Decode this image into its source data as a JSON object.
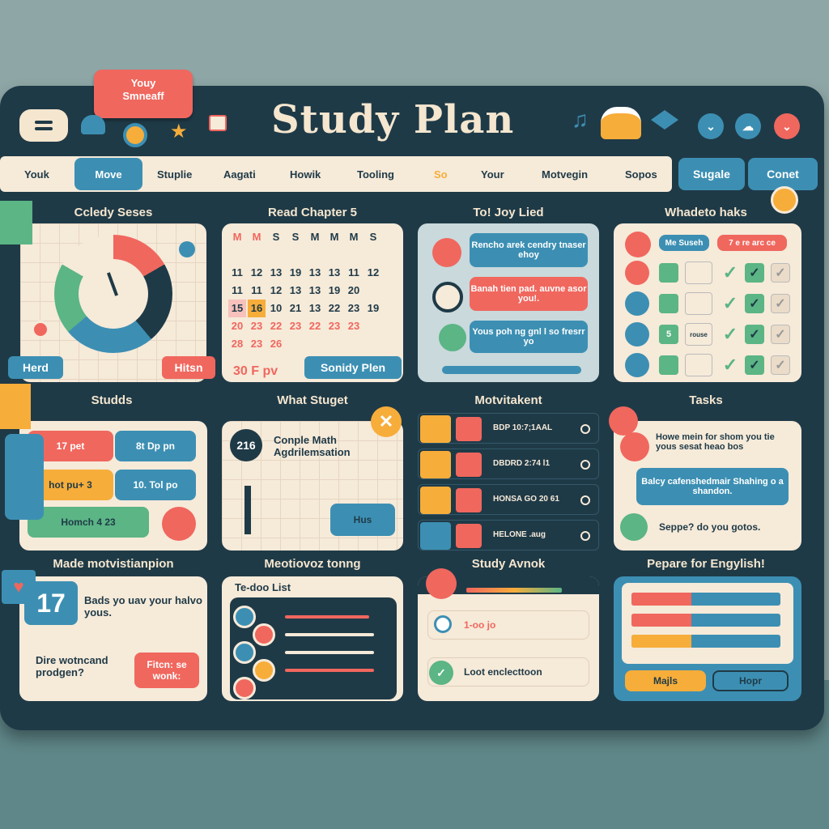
{
  "header": {
    "title": "Study Plan",
    "note": "Youy\nSmneaff"
  },
  "nav": {
    "items": [
      "Youk",
      "Move",
      "Stuplie",
      "Aagati",
      "Howik",
      "Tooling",
      "So",
      "Your",
      "Motvegin",
      "Sopos"
    ],
    "right_primary": "Sugale",
    "right_secondary": "Conet"
  },
  "panels": {
    "p1": {
      "title": "Ccledy Seses",
      "left_btn": "Herd",
      "right_btn": "Hitsn"
    },
    "p2": {
      "title": "Read Chapter 5",
      "footer_text": "30 F pv",
      "footer_btn": "Sonidy Plen",
      "cal_header": [
        "M",
        "M",
        "S",
        "S",
        "M",
        "M",
        "M",
        "S"
      ],
      "cal_rows": [
        [
          "",
          "",
          "",
          "",
          "",
          "",
          "",
          ""
        ],
        [
          "11",
          "12",
          "13",
          "19",
          "13",
          "13",
          "11",
          "12"
        ],
        [
          "11",
          "11",
          "12",
          "13",
          "13",
          "19",
          "20",
          ""
        ],
        [
          "15",
          "16",
          "10",
          "21",
          "13",
          "22",
          "23",
          "19"
        ],
        [
          "20",
          "23",
          "22",
          "23",
          "22",
          "23",
          "23",
          ""
        ],
        [
          "28",
          "23",
          "26",
          "",
          "",
          "",
          "",
          ""
        ]
      ]
    },
    "p3": {
      "title": "To! Joy Lied",
      "msg1": "Rencho arek cendry tnaser ehoy",
      "msg2": "Banah tien pad. auvne asor you!.",
      "msg3": "Yous poh ng gnl l so fresrr yo"
    },
    "p4": {
      "title": "Whadeto haks",
      "tag1": "Me Suseh",
      "tag2": "7 e re arc ce",
      "row_label": "rouse",
      "row_num": "5"
    },
    "p5": {
      "title": "Studds",
      "chips": [
        "17 pet",
        "8t Dp pn",
        "hot pu+ 3",
        "10. Tol po",
        "Homch 4 23"
      ]
    },
    "p6": {
      "title": "What Stuget",
      "badge": "216",
      "text": "Conple Math Agdrilemsation",
      "btn": "Hus"
    },
    "p7": {
      "title": "Motvitakent",
      "rows": [
        "BDP 10:7;1AAL",
        "DBDRD 2:74 l1",
        "HONSA GO 20 61",
        "HELONE .aug"
      ]
    },
    "p8": {
      "title": "Tasks",
      "text1": "Howe mein for shom you tie yous sesat heao bos",
      "text2": "Balcy cafenshedmair Shahing o a shandon.",
      "text3": "Seppe? do you gotos."
    },
    "p9": {
      "title": "Made motvistianpion",
      "date": "17",
      "text1": "Bads yo uav your halvo yous.",
      "text2": "Dire wotncand prodgen?",
      "btn": "Fitcn: se wonk:"
    },
    "p10": {
      "title": "Meotiovoz tonng",
      "list_title": "Te-doo List"
    },
    "p11": {
      "title": "Study Avnok",
      "item1": "1-oo jo",
      "item2": "Loot enclecttoon"
    },
    "p12": {
      "title": "Pepare for Engylish!",
      "btn1": "Majls",
      "btn2": "Hopr",
      "progress": [
        0.4,
        0.4,
        0.4
      ]
    }
  },
  "colors": {
    "navy": "#1f3a47",
    "cream": "#f6ead9",
    "coral": "#f0675e",
    "teal": "#3c8fb3",
    "green": "#5bb585",
    "orange": "#f7ad3a"
  }
}
